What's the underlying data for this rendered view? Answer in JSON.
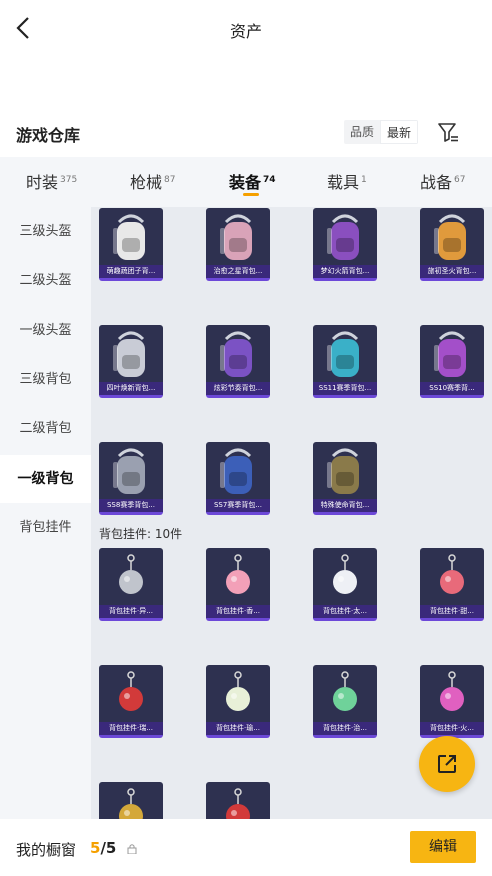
{
  "header": {
    "title": "资产"
  },
  "section": {
    "title": "游戏仓库",
    "sort_options": [
      "品质",
      "最新"
    ],
    "active_sort": "最新"
  },
  "tabs": [
    {
      "label": "时装",
      "count": "375"
    },
    {
      "label": "枪械",
      "count": "87"
    },
    {
      "label": "装备",
      "count": "74"
    },
    {
      "label": "载具",
      "count": "1"
    },
    {
      "label": "战备",
      "count": "67"
    }
  ],
  "sidebar": {
    "items": [
      {
        "label": "三级头盔"
      },
      {
        "label": "二级头盔"
      },
      {
        "label": "一级头盔"
      },
      {
        "label": "三级背包"
      },
      {
        "label": "二级背包"
      },
      {
        "label": "一级背包"
      },
      {
        "label": "背包挂件"
      }
    ]
  },
  "backpacks": [
    {
      "label": "萌趣蔬团子背...",
      "icon": "white-bunny-backpack-icon",
      "color": "#e8e8e8"
    },
    {
      "label": "治愈之星背包...",
      "icon": "pink-star-backpack-icon",
      "color": "#d9a3b8"
    },
    {
      "label": "梦幻火箭背包...",
      "icon": "rocket-backpack-icon",
      "color": "#8a4fbf"
    },
    {
      "label": "旅初圣火背包...",
      "icon": "flame-backpack-icon",
      "color": "#e09a3c"
    },
    {
      "label": "四叶焕新背包...",
      "icon": "silver-backpack-icon",
      "color": "#c9ccd6"
    },
    {
      "label": "炫彩节奏背包...",
      "icon": "color-rhythm-backpack-icon",
      "color": "#7b52c4"
    },
    {
      "label": "SS11赛季背包...",
      "icon": "season-ss11-backpack-icon",
      "color": "#3ab0c8"
    },
    {
      "label": "SS10赛季背...",
      "icon": "season-ss10-backpack-icon",
      "color": "#a34fc9"
    },
    {
      "label": "SS8赛季背包...",
      "icon": "season-ss8-backpack-icon",
      "color": "#9aa0b0"
    },
    {
      "label": "SS7赛季背包...",
      "icon": "season-ss7-backpack-icon",
      "color": "#3c5fb8"
    },
    {
      "label": "特殊使命背包...",
      "icon": "mission-backpack-icon",
      "color": "#8a7a4a"
    }
  ],
  "pendant_group": {
    "label": "背包挂件: 10件"
  },
  "pendants": [
    {
      "label": "背包挂件·异...",
      "icon": "crown-pendant-icon",
      "color": "#c0c4cc"
    },
    {
      "label": "背包挂件·香...",
      "icon": "flower-pendant-icon",
      "color": "#f3a0b8"
    },
    {
      "label": "背包挂件·太...",
      "icon": "astronaut-pendant-icon",
      "color": "#eef0f5"
    },
    {
      "label": "背包挂件·甜...",
      "icon": "paw-pendant-icon",
      "color": "#e86a7a"
    },
    {
      "label": "背包挂件·瑞...",
      "icon": "knot-pendant-icon",
      "color": "#d23a3a"
    },
    {
      "label": "背包挂件·瑜...",
      "icon": "sprout-pendant-icon",
      "color": "#e8f0d8"
    },
    {
      "label": "背包挂件·治...",
      "icon": "bottle-pendant-icon",
      "color": "#6fd29a"
    },
    {
      "label": "背包挂件·火...",
      "icon": "flame-pendant-icon",
      "color": "#e060c0"
    },
    {
      "label": "",
      "icon": "gold-emblem-pendant-icon",
      "color": "#d4a83a"
    },
    {
      "label": "",
      "icon": "red-tassel-pendant-icon",
      "color": "#d23a3a"
    }
  ],
  "footer": {
    "label": "我的橱窗",
    "current": "5",
    "total": "/5",
    "edit_label": "编辑"
  },
  "colors": {
    "accent": "#f7b512",
    "card_bg": "#2e3150",
    "card_border": "#6c48d8"
  }
}
